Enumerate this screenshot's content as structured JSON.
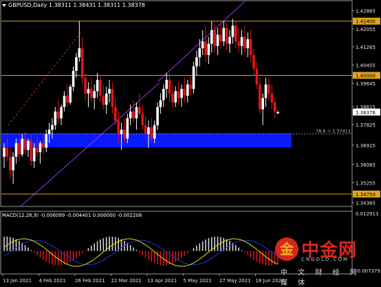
{
  "window": {
    "title": "GBPUSD,Daily  1.38311 1.38431 1.38311 1.38378"
  },
  "watermark": {
    "brand": "中金网",
    "site": "CNGOLD.COM",
    "tagline": "中 文 财 经 网 媒 体",
    "logo_glyph": "金"
  },
  "colors": {
    "background": "#000000",
    "bull": "#ffffff",
    "bear": "#e01616",
    "level_line": "#e0a51c",
    "channel": "#9b30ff",
    "zone": "#0a1aff",
    "macd_main": "#f0e010",
    "macd_signal": "#1e3ad8"
  },
  "chart_data": [
    {
      "type": "candlestick",
      "symbol": "GBPUSD",
      "timeframe": "Daily",
      "ohlc_header": {
        "open": 1.38311,
        "high": 1.38431,
        "low": 1.38311,
        "close": 1.38378
      },
      "y_ticks": [
        "1.42865",
        "1.42055",
        "1.41265",
        "1.40455",
        "1.39645",
        "1.38615",
        "1.37825",
        "1.36915",
        "1.36065",
        "1.35255",
        "1.34365"
      ],
      "ylim": [
        1.342,
        1.43
      ],
      "x_ticks": [
        "13 Jan 2021",
        "4 Feb 2021",
        "26 Feb 2021",
        "22 Mar 2021",
        "13 Apr 2021",
        "5 May 2021",
        "27 May 2021",
        "18 Jun 2021"
      ],
      "levels": [
        {
          "value": 1.424,
          "label": "1.42400"
        },
        {
          "value": 1.4,
          "label": "1.40000"
        },
        {
          "value": 1.3475,
          "label": "1.34750"
        }
      ],
      "fib_annotation": {
        "label": "78.6 = 1.37411",
        "value": 1.37411
      },
      "current_price": {
        "value": 1.38378,
        "label": "1.38378"
      },
      "support_zone": [
        1.3681,
        1.3743
      ],
      "channel": "rising channel",
      "candles": [
        [
          1.364,
          1.37,
          1.359,
          1.368
        ],
        [
          1.368,
          1.372,
          1.362,
          1.364
        ],
        [
          1.364,
          1.368,
          1.354,
          1.358
        ],
        [
          1.358,
          1.366,
          1.352,
          1.364
        ],
        [
          1.364,
          1.372,
          1.361,
          1.37
        ],
        [
          1.37,
          1.372,
          1.362,
          1.365
        ],
        [
          1.365,
          1.374,
          1.364,
          1.372
        ],
        [
          1.372,
          1.375,
          1.365,
          1.367
        ],
        [
          1.367,
          1.372,
          1.364,
          1.371
        ],
        [
          1.371,
          1.374,
          1.36,
          1.362
        ],
        [
          1.362,
          1.37,
          1.359,
          1.368
        ],
        [
          1.368,
          1.372,
          1.364,
          1.366
        ],
        [
          1.366,
          1.371,
          1.361,
          1.37
        ],
        [
          1.37,
          1.374,
          1.365,
          1.368
        ],
        [
          1.368,
          1.376,
          1.366,
          1.374
        ],
        [
          1.374,
          1.379,
          1.37,
          1.376
        ],
        [
          1.376,
          1.381,
          1.372,
          1.378
        ],
        [
          1.378,
          1.386,
          1.376,
          1.384
        ],
        [
          1.384,
          1.389,
          1.379,
          1.381
        ],
        [
          1.381,
          1.387,
          1.378,
          1.386
        ],
        [
          1.386,
          1.393,
          1.384,
          1.391
        ],
        [
          1.391,
          1.396,
          1.386,
          1.388
        ],
        [
          1.388,
          1.396,
          1.387,
          1.395
        ],
        [
          1.395,
          1.404,
          1.393,
          1.402
        ],
        [
          1.402,
          1.41,
          1.399,
          1.408
        ],
        [
          1.408,
          1.424,
          1.406,
          1.412
        ],
        [
          1.412,
          1.417,
          1.396,
          1.399
        ],
        [
          1.399,
          1.401,
          1.389,
          1.392
        ],
        [
          1.392,
          1.397,
          1.386,
          1.394
        ],
        [
          1.394,
          1.399,
          1.388,
          1.39
        ],
        [
          1.39,
          1.396,
          1.385,
          1.393
        ],
        [
          1.393,
          1.401,
          1.39,
          1.398
        ],
        [
          1.398,
          1.4,
          1.388,
          1.391
        ],
        [
          1.391,
          1.396,
          1.385,
          1.387
        ],
        [
          1.387,
          1.395,
          1.383,
          1.392
        ],
        [
          1.392,
          1.398,
          1.388,
          1.394
        ],
        [
          1.394,
          1.397,
          1.383,
          1.386
        ],
        [
          1.386,
          1.39,
          1.378,
          1.38
        ],
        [
          1.38,
          1.384,
          1.37,
          1.374
        ],
        [
          1.374,
          1.379,
          1.367,
          1.376
        ],
        [
          1.376,
          1.381,
          1.37,
          1.372
        ],
        [
          1.372,
          1.383,
          1.37,
          1.381
        ],
        [
          1.381,
          1.387,
          1.378,
          1.384
        ],
        [
          1.384,
          1.389,
          1.379,
          1.381
        ],
        [
          1.381,
          1.388,
          1.376,
          1.386
        ],
        [
          1.386,
          1.392,
          1.382,
          1.383
        ],
        [
          1.383,
          1.387,
          1.376,
          1.378
        ],
        [
          1.378,
          1.382,
          1.372,
          1.374
        ],
        [
          1.374,
          1.38,
          1.368,
          1.377
        ],
        [
          1.377,
          1.381,
          1.37,
          1.372
        ],
        [
          1.372,
          1.38,
          1.37,
          1.378
        ],
        [
          1.378,
          1.388,
          1.376,
          1.386
        ],
        [
          1.386,
          1.392,
          1.383,
          1.389
        ],
        [
          1.389,
          1.396,
          1.386,
          1.394
        ],
        [
          1.394,
          1.401,
          1.39,
          1.398
        ],
        [
          1.398,
          1.401,
          1.388,
          1.392
        ],
        [
          1.392,
          1.396,
          1.386,
          1.388
        ],
        [
          1.388,
          1.395,
          1.386,
          1.393
        ],
        [
          1.393,
          1.397,
          1.387,
          1.39
        ],
        [
          1.39,
          1.396,
          1.386,
          1.394
        ],
        [
          1.394,
          1.399,
          1.388,
          1.391
        ],
        [
          1.391,
          1.398,
          1.388,
          1.396
        ],
        [
          1.396,
          1.4,
          1.391,
          1.394
        ],
        [
          1.394,
          1.406,
          1.392,
          1.404
        ],
        [
          1.404,
          1.411,
          1.4,
          1.408
        ],
        [
          1.408,
          1.416,
          1.404,
          1.412
        ],
        [
          1.412,
          1.42,
          1.409,
          1.415
        ],
        [
          1.415,
          1.422,
          1.406,
          1.409
        ],
        [
          1.409,
          1.417,
          1.405,
          1.414
        ],
        [
          1.414,
          1.424,
          1.41,
          1.42
        ],
        [
          1.42,
          1.423,
          1.41,
          1.413
        ],
        [
          1.413,
          1.421,
          1.409,
          1.418
        ],
        [
          1.418,
          1.423,
          1.412,
          1.415
        ],
        [
          1.415,
          1.424,
          1.413,
          1.421
        ],
        [
          1.421,
          1.423,
          1.411,
          1.414
        ],
        [
          1.414,
          1.42,
          1.41,
          1.417
        ],
        [
          1.417,
          1.425,
          1.414,
          1.422
        ],
        [
          1.422,
          1.424,
          1.412,
          1.415
        ],
        [
          1.415,
          1.421,
          1.41,
          1.413
        ],
        [
          1.413,
          1.42,
          1.409,
          1.417
        ],
        [
          1.417,
          1.422,
          1.41,
          1.412
        ],
        [
          1.412,
          1.419,
          1.408,
          1.416
        ],
        [
          1.416,
          1.42,
          1.406,
          1.409
        ],
        [
          1.409,
          1.412,
          1.4,
          1.403
        ],
        [
          1.403,
          1.406,
          1.394,
          1.396
        ],
        [
          1.396,
          1.399,
          1.383,
          1.385
        ],
        [
          1.385,
          1.392,
          1.378,
          1.39
        ],
        [
          1.39,
          1.399,
          1.386,
          1.396
        ],
        [
          1.396,
          1.399,
          1.389,
          1.392
        ],
        [
          1.392,
          1.396,
          1.385,
          1.388
        ],
        [
          1.388,
          1.39,
          1.381,
          1.384
        ],
        [
          1.3831,
          1.3843,
          1.3831,
          1.3838
        ]
      ]
    },
    {
      "type": "bar",
      "indicator": "MACD",
      "label": "MACD(12,26,9) -0.006099 -0.004401 0.000000 -0.002208",
      "y_ticks": [
        "0.012913",
        "-0.007379"
      ],
      "ylim": [
        -0.0075,
        0.013
      ]
    }
  ]
}
